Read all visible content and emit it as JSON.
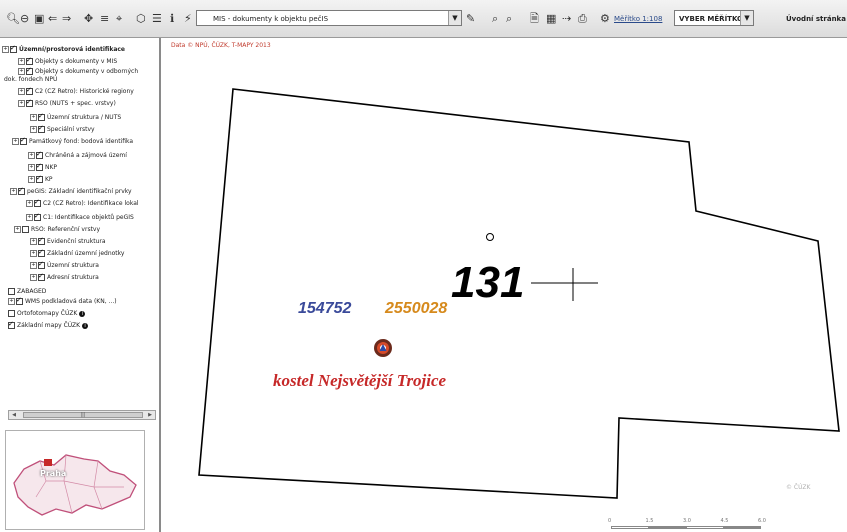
{
  "toolbar": {
    "layer_select": "MIS - dokumenty k objektu pečIS",
    "scale_label": "Měřítko 1:108",
    "scale_select": "VYBER MĚŘÍTKO",
    "home_label": "Úvodní stránka"
  },
  "tree": {
    "items": [
      {
        "label": "Územní/prostorová identifikace",
        "bold": true
      },
      {
        "label": "Objekty s dokumenty v MIS"
      },
      {
        "label": "Objekty s dokumenty v odborných"
      },
      {
        "label": "dok. fondech NPÚ"
      },
      {
        "label": "C2 (CZ Retro): Historické regiony"
      },
      {
        "label": "RSO (NUTS + spec. vrstvy)"
      },
      {
        "label": "Územní struktura / NUTS"
      },
      {
        "label": "Speciální vrstvy"
      },
      {
        "label": "Památkový fond: bodová identifika"
      },
      {
        "label": "Chráněná a zájmová území"
      },
      {
        "label": "NKP"
      },
      {
        "label": "KP"
      },
      {
        "label": "peGIS: Základní identifikační prvky"
      },
      {
        "label": "C2 (CZ Retro): Identifikace lokal"
      },
      {
        "label": "C1: Identifikace objektů peGIS"
      },
      {
        "label": "RSO: Referenční vrstvy"
      },
      {
        "label": "Evidenční struktura"
      },
      {
        "label": "Základní územní jednotky"
      },
      {
        "label": "Územní struktura"
      },
      {
        "label": "Adresní struktura"
      },
      {
        "label": "ZABAGED"
      },
      {
        "label": "WMS podkladová data (KN, ...)"
      },
      {
        "label": "Ortofotomapy ČÚZK"
      },
      {
        "label": "Základní mapy ČÚZK"
      }
    ]
  },
  "overview": {
    "city_label": "Praha"
  },
  "map": {
    "copyright": "Data © NPÚ, ČÚZK, T-MAPY 2013",
    "parcel_number": "131",
    "id_blue": "154752",
    "id_orange": "2550028",
    "church_label": "kostel Nejsvětější Trojice",
    "watermark": "© ČÚZK",
    "scale_ticks": [
      "0",
      "1.5",
      "3.0",
      "4.5",
      "6.0"
    ]
  },
  "colors": {
    "label_blue": "#3a4a9a",
    "label_orange": "#d68a1d",
    "label_red": "#c62828",
    "copyright_red": "#c0392b"
  }
}
